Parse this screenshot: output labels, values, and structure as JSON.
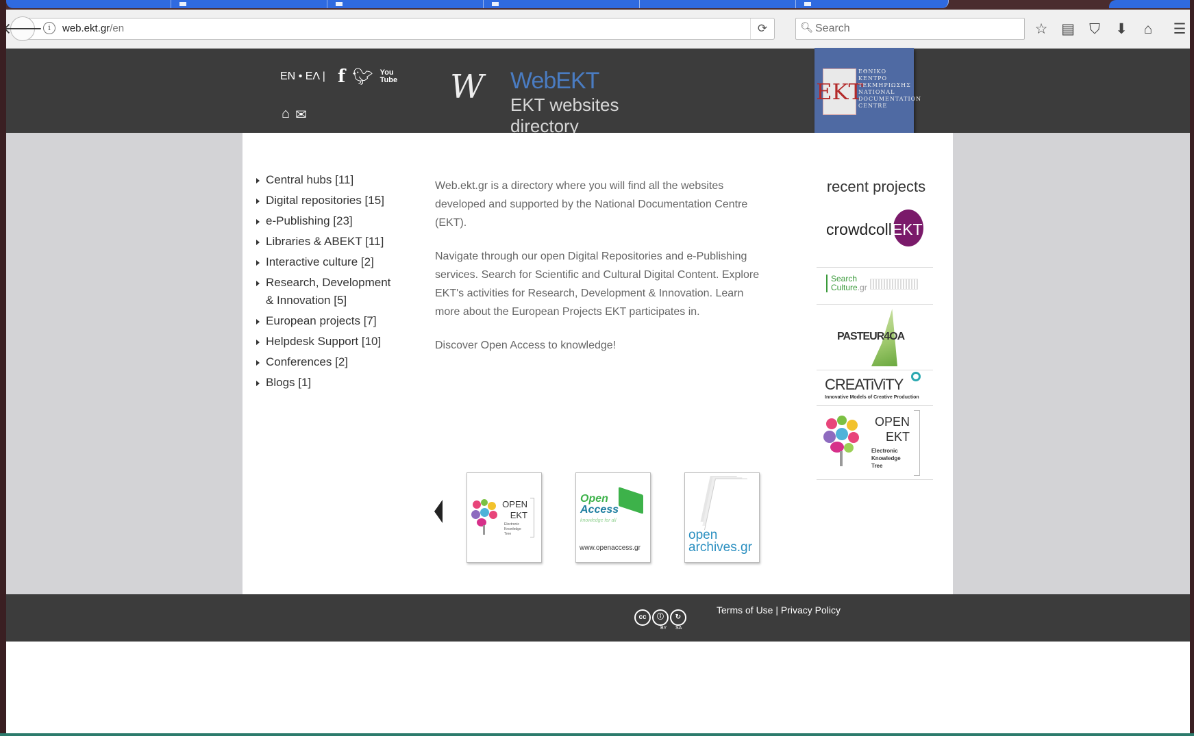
{
  "browser": {
    "url_host": "web.ekt.gr",
    "url_path": "/en",
    "search_placeholder": "Search"
  },
  "header": {
    "lang_en": "EN",
    "lang_sep": "•",
    "lang_el": "ΕΛ",
    "lang_bar": "|",
    "logo_title": "WebEKT",
    "logo_subtitle": "EKT websites directory",
    "badge_mono": "EKT",
    "badge_text": "ΕΘΝΙΚΟ ΚΕΝΤΡΟ ΤΕΚΜΗΡΙΩΣΗΣ NATIONAL DOCUMENTATION CENTRE",
    "youtube_label": "You Tube"
  },
  "categories": [
    "Central hubs [11]",
    "Digital repositories [15]",
    "e-Publishing [23]",
    "Libraries & ABEKT [11]",
    "Interactive culture [2]",
    "Research, Development & Innovation [5]",
    "European projects [7]",
    "Helpdesk Support [10]",
    "Conferences [2]",
    "Blogs [1]"
  ],
  "intro": {
    "p1": "Web.ekt.gr is a directory where you will find all the websites developed and supported by the National Documentation Centre (EKT).",
    "p2": "Navigate through our open Digital Repositories and e-Publishing services. Search for Scientific and Cultural Digital Content. Explore EKT's activities for Research, Development & Innovation. Learn more about the European Projects EKT participates in.",
    "p3": "Discover Open Access to knowledge!"
  },
  "recent": {
    "title": "recent projects",
    "crowdcoll_a": "crowdcoll",
    "crowdcoll_b": "EKT",
    "searchculture": "Search Culture",
    "searchculture_gr": ".gr",
    "pasteur": "PASTEUR4OA",
    "creativity": "CREATiViTY",
    "creativity_sub": "Innovative Models of Creative Production",
    "openekt_a": "OPEN",
    "openekt_b": "EKT",
    "openekt_c": "Electronic Knowledge Tree"
  },
  "carousel": {
    "s1_a": "OPEN",
    "s1_b": "EKT",
    "s1_c": "Electronic Knowledge Tree",
    "s2_a": "Open",
    "s2_b": "Access",
    "s2_c": "knowledge for all",
    "s2_url": "www.openaccess.gr",
    "s3_a": "open",
    "s3_b": "archives.gr"
  },
  "footer": {
    "terms": "Terms of Use",
    "sep": "|",
    "privacy": "Privacy Policy",
    "cc_by": "BY",
    "cc_sa": "SA"
  },
  "colors": {
    "header_bg": "#3c3c3c",
    "accent_blue": "#4a7cc2",
    "badge_blue": "#4f6aa3",
    "crowdcoll_purple": "#7a1a6a",
    "openaccess_green": "#3db24a"
  }
}
